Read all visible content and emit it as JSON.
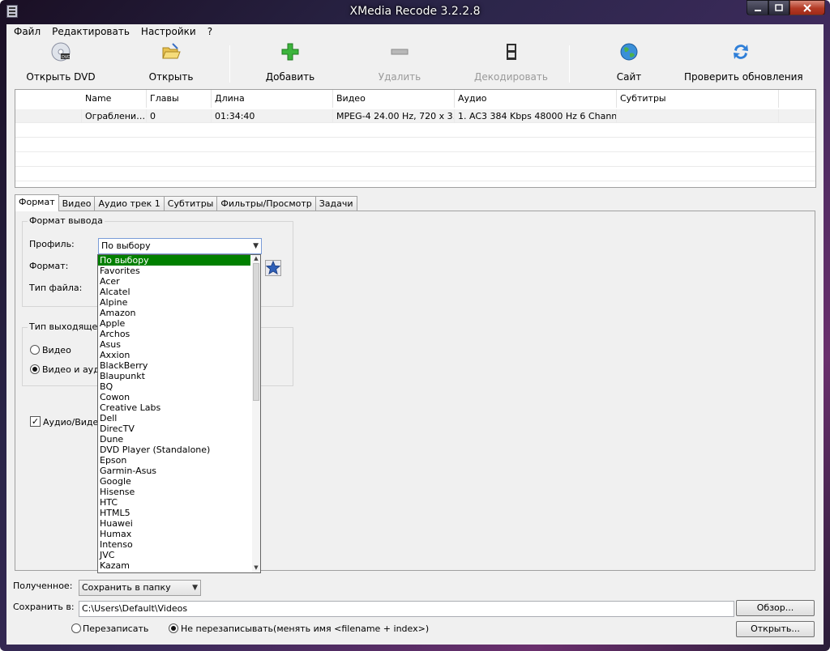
{
  "window": {
    "title": "XMedia Recode 3.2.2.8",
    "min": "0",
    "max": "1",
    "close": "r"
  },
  "menu": [
    "Файл",
    "Редактировать",
    "Настройки",
    "?"
  ],
  "toolbar": {
    "open_dvd": "Открыть DVD",
    "open": "Открыть",
    "add": "Добавить",
    "remove": "Удалить",
    "decode": "Декодировать",
    "site": "Сайт",
    "check_updates": "Проверить обновления"
  },
  "filelist": {
    "columns": [
      "Name",
      "Главы",
      "Длина",
      "Видео",
      "Аудио",
      "Субтитры"
    ],
    "rows": [
      {
        "name": "Ограблени…",
        "chapters": "0",
        "length": "01:34:40",
        "video": "MPEG-4 24.00 Hz, 720 x 3…",
        "audio": "1. AC3 384 Kbps 48000 Hz 6 Chann…",
        "subtitles": ""
      }
    ]
  },
  "tabs": [
    "Формат",
    "Видео",
    "Аудио трек 1",
    "Субтитры",
    "Фильтры/Просмотр",
    "Задачи"
  ],
  "format_panel": {
    "output_group": "Формат вывода",
    "profile_label": "Профиль:",
    "profile_value": "По выбору",
    "format_label": "Формат:",
    "filetype_label": "Тип файла:",
    "stream_group": "Тип выходящего",
    "radio_video": "Видео",
    "radio_video_audio": "Видео и ауди",
    "checkbox_av": "Аудио/Видео"
  },
  "profile_options": [
    "По выбору",
    "Favorites",
    "Acer",
    "Alcatel",
    "Alpine",
    "Amazon",
    "Apple",
    "Archos",
    "Asus",
    "Axxion",
    "BlackBerry",
    "Blaupunkt",
    "BQ",
    "Cowon",
    "Creative Labs",
    "Dell",
    "DirecTV",
    "Dune",
    "DVD Player (Standalone)",
    "Epson",
    "Garmin-Asus",
    "Google",
    "Hisense",
    "HTC",
    "HTML5",
    "Huawei",
    "Humax",
    "Intenso",
    "JVC",
    "Kazam"
  ],
  "bottom": {
    "received_label": "Полученное:",
    "received_value": "Сохранить в папку",
    "save_to_label": "Сохранить в:",
    "save_path": "C:\\Users\\Default\\Videos",
    "browse": "Обзор...",
    "overwrite": "Перезаписать",
    "no_overwrite": "Не перезаписывать(менять имя <filename + index>)",
    "open": "Открыть..."
  }
}
